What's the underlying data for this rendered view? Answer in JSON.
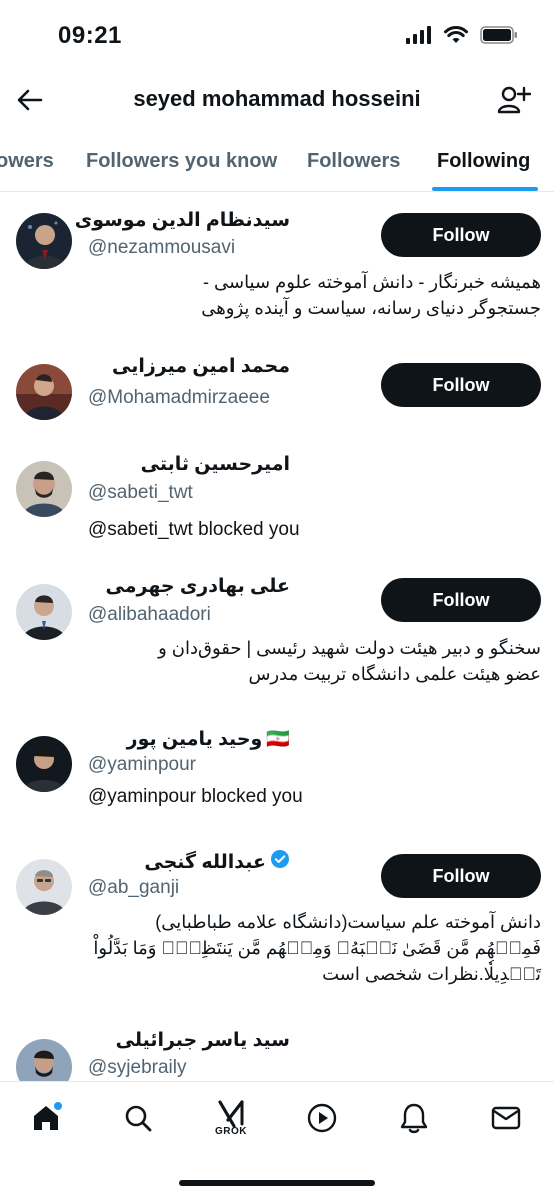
{
  "status_bar": {
    "time": "09:21"
  },
  "header": {
    "title": "seyed mohammad hosseini"
  },
  "tabs": [
    {
      "label": "owers"
    },
    {
      "label": "Followers you know"
    },
    {
      "label": "Followers"
    },
    {
      "label": "Following"
    }
  ],
  "accent_color": "#1d9bf0",
  "users": [
    {
      "name": "سیدنظام الدین موسوی",
      "handle": "@nezammousavi",
      "button": "Follow",
      "bio": [
        "همیشه خبرنگار - دانش آموخته علوم سیاسی -",
        "جستجوگر دنیای رسانه، سیاست و آینده پژوهی"
      ]
    },
    {
      "name": "محمد امین میرزایی",
      "handle": "@Mohamadmirzaeee",
      "button": "Follow"
    },
    {
      "name": "امیرحسین ثابتی",
      "handle": "@sabeti_twt",
      "status": "@sabeti_twt blocked you"
    },
    {
      "name": "علی بهادری جهرمی",
      "handle": "@alibahaadori",
      "button": "Follow",
      "bio": [
        "سخنگو و دبیر هیئت دولت شهید رئیسی | حقوق‌دان و",
        "عضو هیئت علمی دانشگاه تربیت مدرس"
      ]
    },
    {
      "name": "وحید یامین پور",
      "flag": "🇮🇷",
      "handle": "@yaminpour",
      "status": "@yaminpour blocked you"
    },
    {
      "name": "عبدالله گنجی",
      "handle": "@ab_ganji",
      "verified": true,
      "button": "Follow",
      "bio": [
        "دانش آموخته علم سیاست(دانشگاه علامه طباطبایی)",
        "فَمِنۡهُم مَّن قَضَىٰ نَحۡبَهُۥ وَمِنۡهُم مَّن يَنتَظِرُۖ وَمَا بَدَّلُواْ",
        "تَبۡدِيلٗا.نظرات شخصی است"
      ]
    },
    {
      "name": "سید یاسر جبرائیلی",
      "handle": "@syjebraily"
    }
  ],
  "nav": {
    "home_icon": "home-icon",
    "search_icon": "search-icon",
    "grok_label": "GROK",
    "video_icon": "play-icon",
    "notifications_icon": "bell-icon",
    "messages_icon": "envelope-icon"
  }
}
